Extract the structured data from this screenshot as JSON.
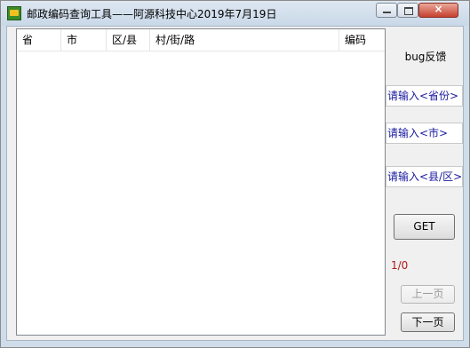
{
  "window": {
    "title": "邮政编码查询工具——阿源科技中心2019年7月19日",
    "close_glyph": "×"
  },
  "table": {
    "columns": [
      "省",
      "市",
      "区/县",
      "村/街/路",
      "编码"
    ],
    "rows": []
  },
  "sidebar": {
    "bug_link": "bug反馈",
    "province_placeholder": "请输入<省份>",
    "city_placeholder": "请输入<市>",
    "district_placeholder": "请输入<县/区>",
    "get_button": "GET",
    "page_indicator": "1/0",
    "prev_button": "上一页",
    "next_button": "下一页"
  },
  "colors": {
    "input_text": "#1a1aa0",
    "page_indicator": "#b01818"
  }
}
